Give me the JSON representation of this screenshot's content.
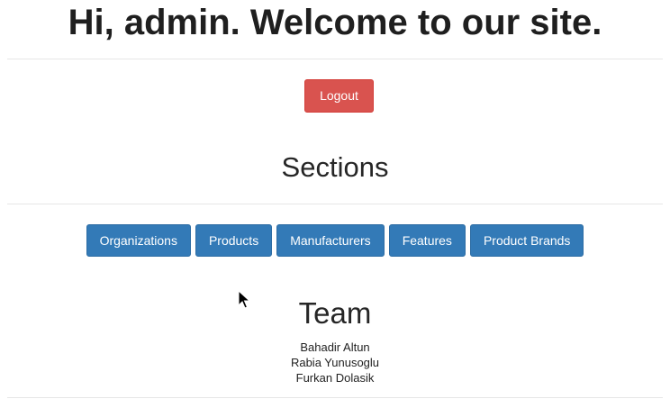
{
  "header": {
    "greeting_prefix": "Hi, ",
    "username": "admin",
    "greeting_suffix": ". Welcome to our site."
  },
  "actions": {
    "logout_label": "Logout"
  },
  "sections": {
    "title": "Sections",
    "buttons": [
      {
        "label": "Organizations"
      },
      {
        "label": "Products"
      },
      {
        "label": "Manufacturers"
      },
      {
        "label": "Features"
      },
      {
        "label": "Product Brands"
      }
    ]
  },
  "team": {
    "title": "Team",
    "members": [
      "Bahadir Altun",
      "Rabia Yunusoglu",
      "Furkan Dolasik"
    ]
  },
  "colors": {
    "danger": "#d9534f",
    "primary": "#337ab7"
  },
  "icons": {
    "cursor": "mouse-pointer-icon"
  }
}
